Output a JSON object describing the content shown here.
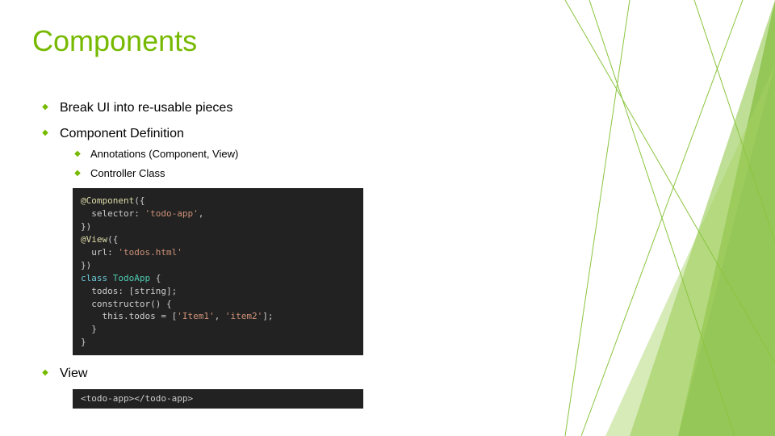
{
  "title": "Components",
  "bullets": {
    "b1": "Break UI into re-usable pieces",
    "b2": "Component Definition",
    "b2a": "Annotations (Component, View)",
    "b2b": "Controller Class",
    "b3": "View"
  },
  "code1": {
    "l1a": "@Component",
    "l1b": "({",
    "l2a": "  selector: ",
    "l2b": "'todo-app'",
    "l2c": ",",
    "l3": "})",
    "l4a": "@View",
    "l4b": "({",
    "l5a": "  url: ",
    "l5b": "'todos.html'",
    "l6": "})",
    "l7a": "class ",
    "l7b": "TodoApp",
    "l7c": " {",
    "l8": "  todos: [string];",
    "l9": "  constructor() {",
    "l10a": "    this.todos = [",
    "l10b": "'Item1'",
    "l10c": ", ",
    "l10d": "'item2'",
    "l10e": "];",
    "l11": "  }",
    "l12": "}"
  },
  "code2": {
    "line": "<todo-app></todo-app>"
  }
}
